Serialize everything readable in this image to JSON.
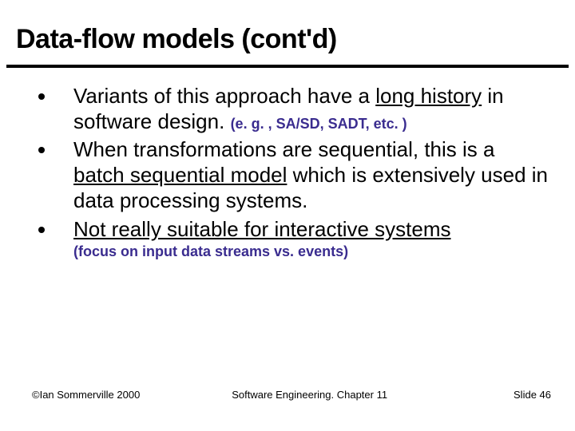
{
  "title": "Data-flow models (cont'd)",
  "bullets": [
    {
      "pre": "Variants of this approach have a ",
      "underlined": "long history",
      "post": " in software design. ",
      "paren": "(e. g. , SA/SD, SADT, etc. )",
      "paren_block": false
    },
    {
      "pre": "When transformations are sequential, this is a ",
      "underlined": "batch sequential model",
      "post": " which is extensively used in data processing systems.",
      "paren": "",
      "paren_block": false
    },
    {
      "pre": "",
      "underlined": "Not really suitable for interactive systems",
      "post": "",
      "paren": "(focus on input data streams vs. events)",
      "paren_block": true
    }
  ],
  "footer": {
    "left": "©Ian Sommerville 2000",
    "center": "Software Engineering. Chapter 11",
    "right": "Slide 46"
  }
}
